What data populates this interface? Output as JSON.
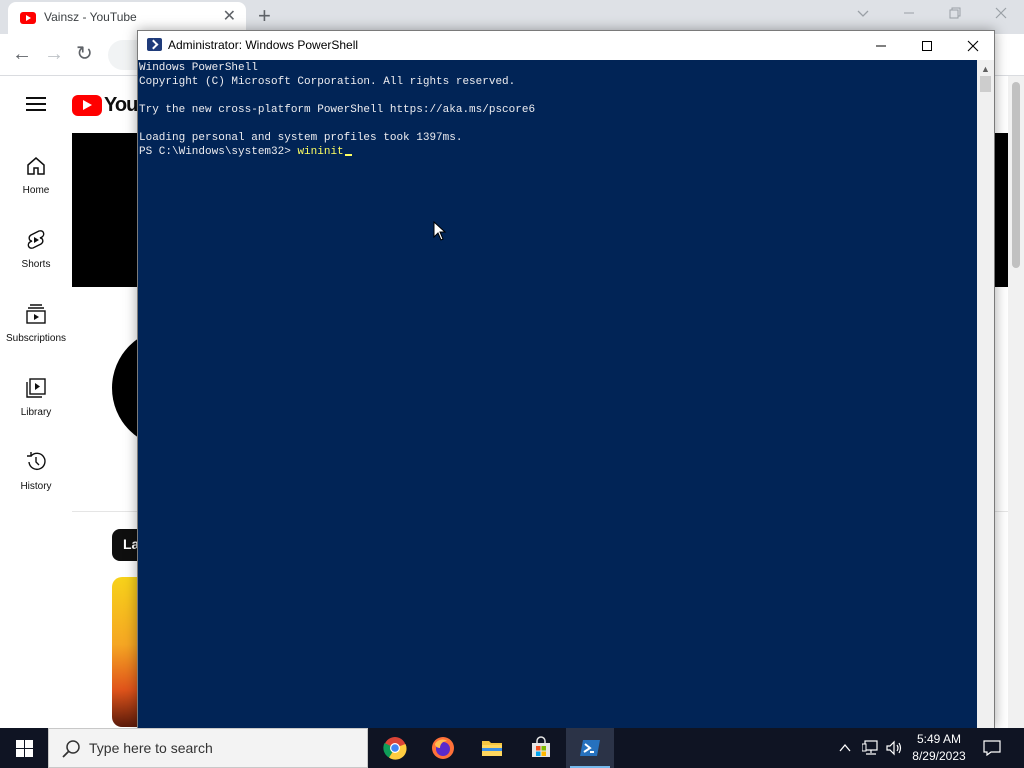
{
  "browser": {
    "tab_title": "Vainsz - YouTube",
    "tab_close": "✕",
    "new_tab": "+",
    "back": "←",
    "forward": "→",
    "reload": "↻"
  },
  "youtube": {
    "logo_text": "YouTube",
    "nav": [
      {
        "label": "Home"
      },
      {
        "label": "Shorts"
      },
      {
        "label": "Subscriptions"
      },
      {
        "label": "Library"
      },
      {
        "label": "History"
      }
    ],
    "chip_label": "La"
  },
  "powershell": {
    "title": "Administrator: Windows PowerShell",
    "lines": [
      "Windows PowerShell",
      "Copyright (C) Microsoft Corporation. All rights reserved.",
      "",
      "Try the new cross-platform PowerShell https://aka.ms/pscore6",
      "",
      "Loading personal and system profiles took 1397ms."
    ],
    "prompt": "PS C:\\Windows\\system32> ",
    "command": "wininit"
  },
  "taskbar": {
    "search_placeholder": "Type here to search",
    "time": "5:49 AM",
    "date": "8/29/2023",
    "apps": [
      {
        "icon": "chrome-icon"
      },
      {
        "icon": "firefox-icon"
      },
      {
        "icon": "file-explorer-icon"
      },
      {
        "icon": "microsoft-store-icon"
      },
      {
        "icon": "powershell-icon",
        "active": true
      }
    ]
  },
  "colors": {
    "powershell_bg": "#012456",
    "powershell_text": "#eeedf0",
    "powershell_command": "#ffff60",
    "youtube_red": "#ff0000",
    "taskbar_bg": "#0f1423"
  }
}
